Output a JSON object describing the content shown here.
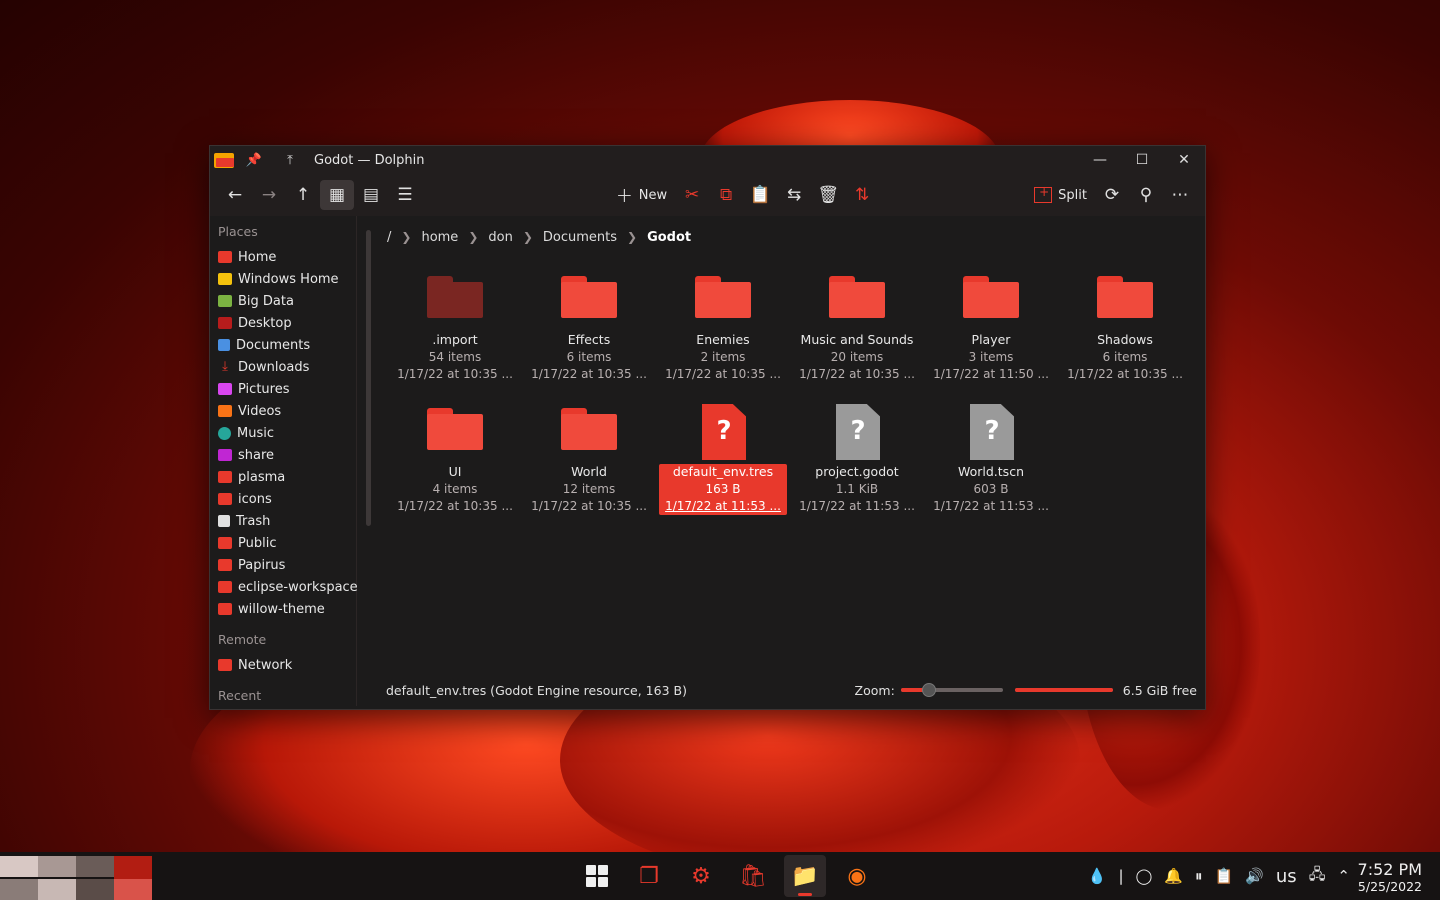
{
  "window": {
    "title": "Godot — Dolphin"
  },
  "toolbar": {
    "new_label": "New",
    "split_label": "Split"
  },
  "sidebar": {
    "places_title": "Places",
    "places": [
      {
        "label": "Home",
        "icon": "home-folder-icon"
      },
      {
        "label": "Windows Home",
        "icon": "folder-icon"
      },
      {
        "label": "Big Data",
        "icon": "folder-icon"
      },
      {
        "label": "Desktop",
        "icon": "desktop-icon"
      },
      {
        "label": "Documents",
        "icon": "documents-icon"
      },
      {
        "label": "Downloads",
        "icon": "downloads-icon"
      },
      {
        "label": "Pictures",
        "icon": "pictures-icon"
      },
      {
        "label": "Videos",
        "icon": "videos-icon"
      },
      {
        "label": "Music",
        "icon": "music-icon"
      },
      {
        "label": "share",
        "icon": "folder-icon"
      },
      {
        "label": "plasma",
        "icon": "folder-icon"
      },
      {
        "label": "icons",
        "icon": "folder-icon"
      },
      {
        "label": "Trash",
        "icon": "trash-icon"
      },
      {
        "label": "Public",
        "icon": "folder-icon"
      },
      {
        "label": "Papirus",
        "icon": "folder-icon"
      },
      {
        "label": "eclipse-workspace",
        "icon": "folder-icon"
      },
      {
        "label": "willow-theme",
        "icon": "folder-icon"
      }
    ],
    "remote_title": "Remote",
    "remote": [
      {
        "label": "Network",
        "icon": "network-icon"
      }
    ],
    "recent_title": "Recent"
  },
  "breadcrumb": {
    "root": "/",
    "parts": [
      "home",
      "don",
      "Documents",
      "Godot"
    ]
  },
  "files": [
    {
      "name": ".import",
      "info": "54 items",
      "date": "1/17/22 at 10:35 ...",
      "type": "folder",
      "dim": true
    },
    {
      "name": "Effects",
      "info": "6 items",
      "date": "1/17/22 at 10:35 ...",
      "type": "folder"
    },
    {
      "name": "Enemies",
      "info": "2 items",
      "date": "1/17/22 at 10:35 ...",
      "type": "folder"
    },
    {
      "name": "Music and Sounds",
      "info": "20 items",
      "date": "1/17/22 at 10:35 ...",
      "type": "folder"
    },
    {
      "name": "Player",
      "info": "3 items",
      "date": "1/17/22 at 11:50 ...",
      "type": "folder"
    },
    {
      "name": "Shadows",
      "info": "6 items",
      "date": "1/17/22 at 10:35 ...",
      "type": "folder"
    },
    {
      "name": "UI",
      "info": "4 items",
      "date": "1/17/22 at 10:35 ...",
      "type": "folder"
    },
    {
      "name": "World",
      "info": "12 items",
      "date": "1/17/22 at 10:35 ...",
      "type": "folder"
    },
    {
      "name": "default_env.tres",
      "info": "163 B",
      "date": "1/17/22 at 11:53 ...",
      "type": "file",
      "selected": true
    },
    {
      "name": "project.godot",
      "info": "1.1 KiB",
      "date": "1/17/22 at 11:53 ...",
      "type": "file"
    },
    {
      "name": "World.tscn",
      "info": "603 B",
      "date": "1/17/22 at 11:53 ...",
      "type": "file"
    }
  ],
  "statusbar": {
    "text": "default_env.tres (Godot Engine resource, 163 B)",
    "zoom_label": "Zoom:",
    "zoom_level": 0.28,
    "space_used_fraction": 1.0,
    "free_label": "6.5 GiB free"
  },
  "taskbar": {
    "time": "7:52 PM",
    "date": "5/25/2022",
    "keyboard_layout": "us"
  },
  "colors": {
    "accent": "#e8392c",
    "window_bg": "#1c1b1b",
    "folder": "#f04a3c"
  }
}
